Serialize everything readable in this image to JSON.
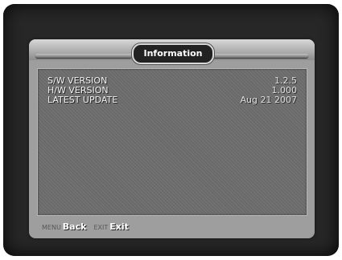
{
  "header": {
    "title": "Information"
  },
  "info_rows": [
    {
      "label": "S/W VERSION",
      "value": "1.2.5"
    },
    {
      "label": "H/W VERSION",
      "value": "1.000"
    },
    {
      "label": "LATEST UPDATE",
      "value": "Aug 21 2007"
    }
  ],
  "footer": {
    "back_key": "MENU",
    "back_label": "Back",
    "exit_key": "EXIT",
    "exit_label": "Exit"
  }
}
